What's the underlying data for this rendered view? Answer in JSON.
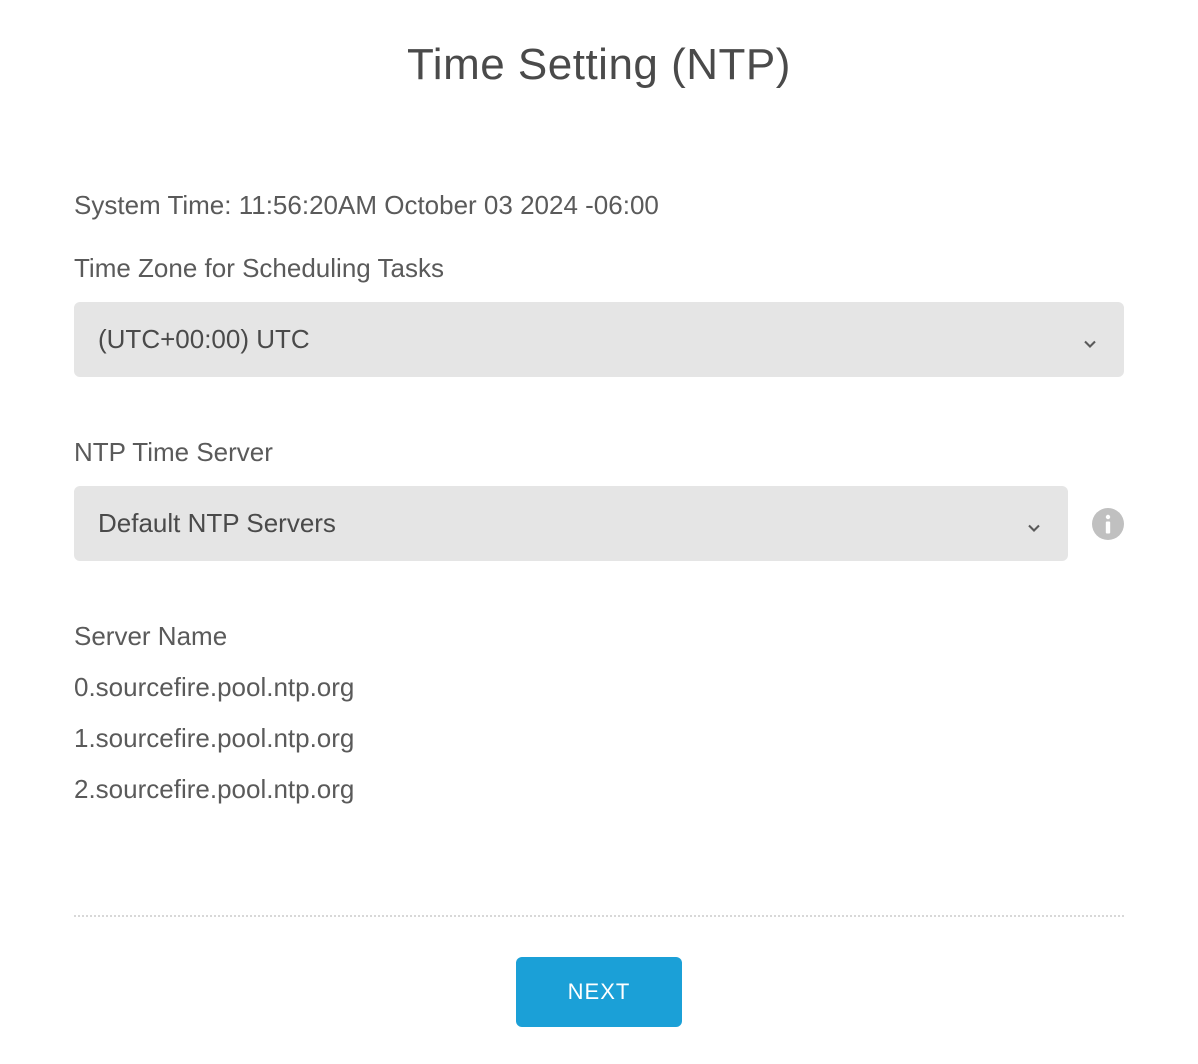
{
  "page": {
    "title": "Time Setting (NTP)"
  },
  "systemTime": {
    "label": "System Time:",
    "value": "11:56:20AM October 03 2024 -06:00"
  },
  "timezone": {
    "label": "Time Zone for Scheduling Tasks",
    "selected": "(UTC+00:00) UTC"
  },
  "ntpServer": {
    "label": "NTP Time Server",
    "selected": "Default NTP Servers"
  },
  "serverList": {
    "header": "Server Name",
    "items": [
      "0.sourcefire.pool.ntp.org",
      "1.sourcefire.pool.ntp.org",
      "2.sourcefire.pool.ntp.org"
    ]
  },
  "actions": {
    "next": "NEXT"
  }
}
